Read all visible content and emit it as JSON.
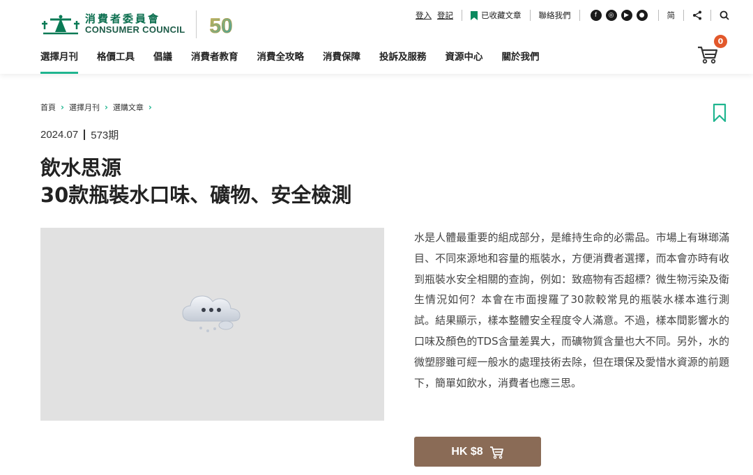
{
  "brand": {
    "name_zh": "消費者委員會",
    "name_en": "CONSUMER COUNCIL",
    "anniversary": "50"
  },
  "topbar": {
    "login": "登入",
    "register": "登記",
    "saved": "已收藏文章",
    "contact": "聯絡我們",
    "social_icons": [
      "facebook-icon",
      "instagram-icon",
      "youtube-icon",
      "wechat-icon"
    ],
    "lang": "简",
    "share_icon": "share-icon",
    "search_icon": "search-icon"
  },
  "nav": {
    "items": [
      {
        "label": "選擇月刊",
        "active": true
      },
      {
        "label": "格價工具"
      },
      {
        "label": "倡議"
      },
      {
        "label": "消費者教育"
      },
      {
        "label": "消費全攻略"
      },
      {
        "label": "消費保障"
      },
      {
        "label": "投訴及服務"
      },
      {
        "label": "資源中心"
      },
      {
        "label": "關於我們"
      }
    ]
  },
  "cart": {
    "count": "0"
  },
  "breadcrumb": [
    "首頁",
    "選擇月刊",
    "選購文章"
  ],
  "article": {
    "date": "2024.07",
    "issue": "573期",
    "title_line1": "飲水思源",
    "title_line2": "30款瓶裝水口味、礦物、安全檢測",
    "description": "水是人體最重要的組成部分，是維持生命的必需品。市場上有琳瑯滿目、不同來源地和容量的瓶裝水，方便消費者選擇，而本會亦時有收到瓶裝水安全相關的查詢，例如：致癌物有否超標？微生物污染及衛生情況如何？本會在市面搜羅了30款較常見的瓶裝水樣本進行測試。結果顯示，樣本整體安全程度令人滿意。不過，樣本間影響水的口味及顏色的TDS含量差異大，而礦物質含量也大不同。另外，水的微塑膠雖可經一般水的處理技術去除，但在環保及愛惜水資源的前題下，簡單如飲水，消費者也應三思。",
    "price": "HK $8"
  },
  "colors": {
    "accent": "#1fb58f",
    "brand_green": "#0a6e4e",
    "buy_button": "#8a6b56",
    "badge": "#e2582b",
    "image_placeholder": "#e1e1e1"
  }
}
